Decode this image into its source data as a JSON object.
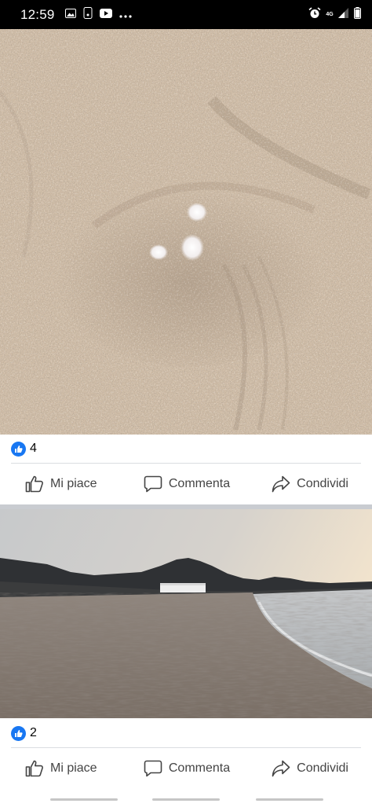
{
  "status_bar": {
    "time": "12:59",
    "left_icons": [
      "image-icon",
      "cast-icon",
      "youtube-icon",
      "more-icon"
    ],
    "right_icons": [
      "alarm-icon",
      "network-4g-icon",
      "signal-icon",
      "battery-icon"
    ],
    "network_label": "4G"
  },
  "posts": [
    {
      "photo_alt": "sand",
      "like_count": "4",
      "actions": {
        "like": "Mi piace",
        "comment": "Commenta",
        "share": "Condividi"
      }
    },
    {
      "photo_alt": "beach",
      "like_count": "2",
      "actions": {
        "like": "Mi piace",
        "comment": "Commenta",
        "share": "Condividi"
      }
    }
  ],
  "colors": {
    "accent": "#1877f2",
    "status_bar": "#000000",
    "separator": "#c9ccd1"
  }
}
